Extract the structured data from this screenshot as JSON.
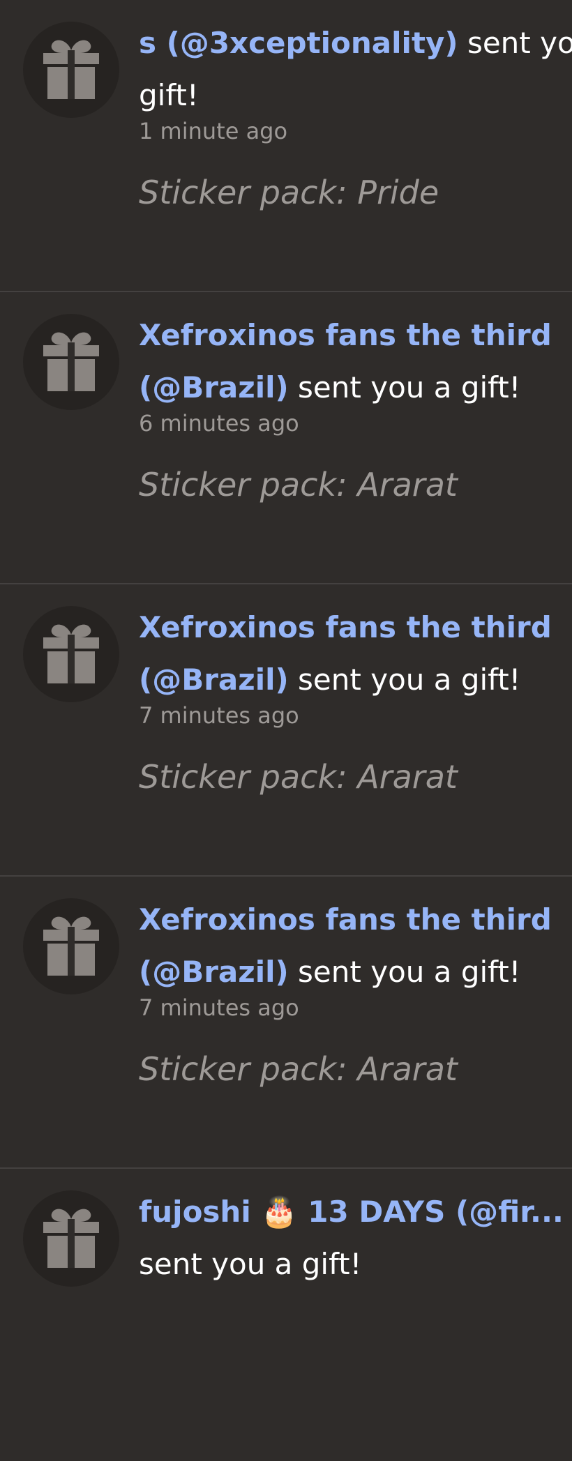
{
  "notifications": [
    {
      "sender": "s (@3xceptionality)",
      "action": " sent you a gift!",
      "time": "1 minute ago",
      "subject": "Sticker pack: Pride",
      "icon": "gift-icon"
    },
    {
      "sender": "Xefroxinos fans the third (@Brazil)",
      "action": " sent you a gift!",
      "time": "6 minutes ago",
      "subject": "Sticker pack: Ararat",
      "icon": "gift-icon"
    },
    {
      "sender": "Xefroxinos fans the third (@Brazil)",
      "action": " sent you a gift!",
      "time": "7 minutes ago",
      "subject": "Sticker pack: Ararat",
      "icon": "gift-icon"
    },
    {
      "sender": "Xefroxinos fans the third (@Brazil)",
      "action": " sent you a gift!",
      "time": "7 minutes ago",
      "subject": "Sticker pack: Ararat",
      "icon": "gift-icon"
    },
    {
      "sender": "fujoshi 🎂 13 DAYS (@fir...",
      "action": " sent you a gift!",
      "time": "",
      "subject": "",
      "icon": "gift-icon"
    }
  ],
  "colors": {
    "background": "#2f2c2a",
    "sender": "#96b5f7",
    "muted": "#9e9a97",
    "avatar_bg": "#262321",
    "icon": "#8a8581"
  }
}
